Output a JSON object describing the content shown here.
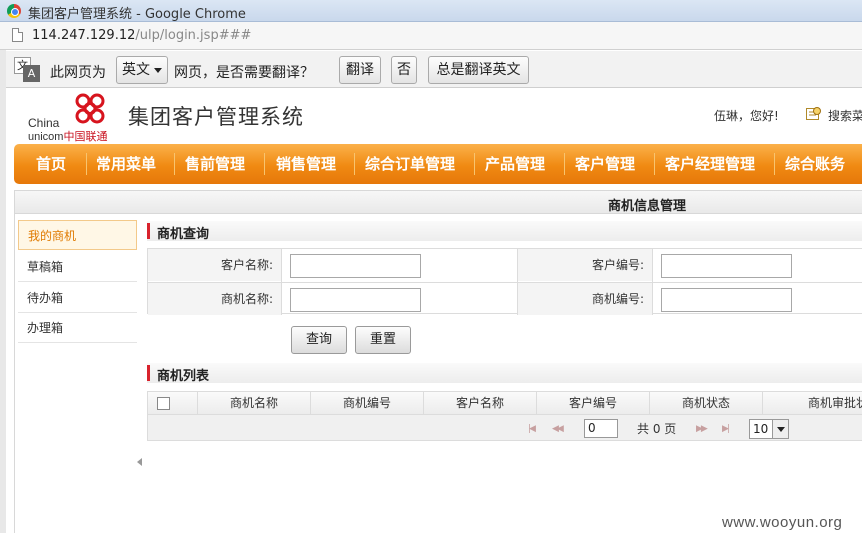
{
  "browser": {
    "window_title": "集团客户管理系统 - Google Chrome",
    "url_host": "114.247.129.12",
    "url_path": "/ulp/login.jsp###"
  },
  "translate_bar": {
    "prefix": "此网页为",
    "language": "英文",
    "suffix": "网页，是否需要翻译？",
    "translate_button": "翻译",
    "no_button": "否",
    "always_button": "总是翻译英文"
  },
  "header": {
    "logo_china": "China",
    "logo_unicom": "unicom",
    "logo_cn": "中国联通",
    "system_title": "集团客户管理系统",
    "greeting": "伍琳，您好!",
    "search_label": "搜索菜"
  },
  "nav": {
    "items": [
      "首页",
      "常用菜单",
      "售前管理",
      "销售管理",
      "综合订单管理",
      "产品管理",
      "客户管理",
      "客户经理管理",
      "综合账务"
    ]
  },
  "page": {
    "title": "商机信息管理"
  },
  "sidebar": {
    "items": [
      "我的商机",
      "草稿箱",
      "待办箱",
      "办理箱"
    ]
  },
  "query": {
    "section_title": "商机查询",
    "customer_name_label": "客户名称:",
    "customer_no_label": "客户编号:",
    "opportunity_name_label": "商机名称:",
    "opportunity_no_label": "商机编号:",
    "customer_name_value": "",
    "customer_no_value": "",
    "opportunity_name_value": "",
    "opportunity_no_value": "",
    "search_button": "查询",
    "reset_button": "重置"
  },
  "list": {
    "section_title": "商机列表",
    "columns": [
      "商机名称",
      "商机编号",
      "客户名称",
      "客户编号",
      "商机状态",
      "商机审批状"
    ],
    "page_input": "0",
    "page_total": "共 0 页",
    "page_size": "10"
  },
  "watermark": "www.wooyun.org",
  "colors": {
    "nav_orange": "#f08a12",
    "accent_red": "#d9232d",
    "active_item": "#e07a00"
  }
}
